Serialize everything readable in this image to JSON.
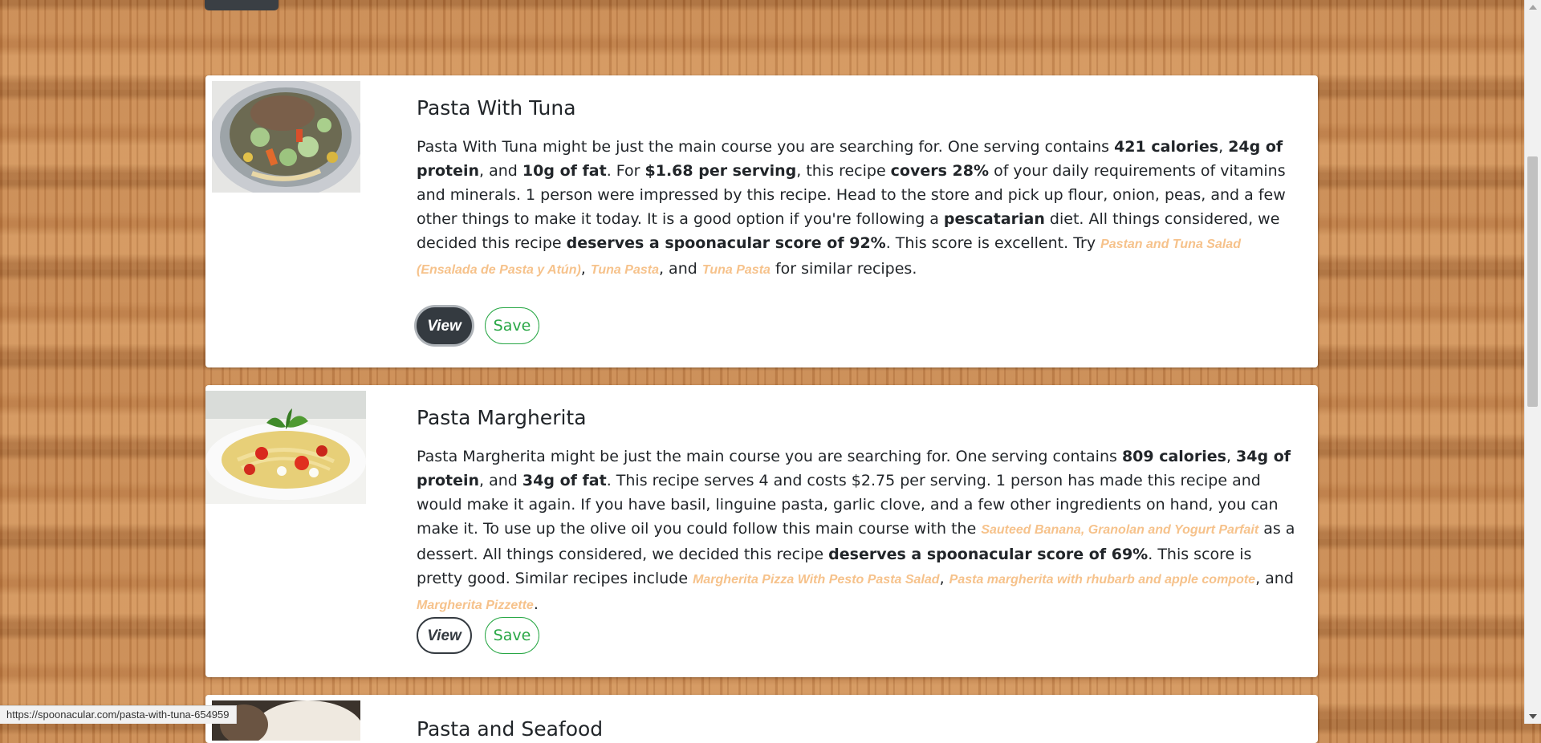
{
  "recipes": [
    {
      "title": "Pasta With Tuna",
      "summary_parts": [
        {
          "t": "text",
          "v": "Pasta With Tuna might be just the main course you are searching for. One serving contains "
        },
        {
          "t": "b",
          "v": "421 calories"
        },
        {
          "t": "text",
          "v": ", "
        },
        {
          "t": "b",
          "v": "24g of protein"
        },
        {
          "t": "text",
          "v": ", and "
        },
        {
          "t": "b",
          "v": "10g of fat"
        },
        {
          "t": "text",
          "v": ". For "
        },
        {
          "t": "b",
          "v": "$1.68 per serving"
        },
        {
          "t": "text",
          "v": ", this recipe "
        },
        {
          "t": "b",
          "v": "covers 28%"
        },
        {
          "t": "text",
          "v": " of your daily requirements of vitamins and minerals. 1 person were impressed by this recipe. Head to the store and pick up flour, onion, peas, and a few other things to make it today. It is a good option if you're following a "
        },
        {
          "t": "b",
          "v": "pescatarian"
        },
        {
          "t": "text",
          "v": " diet. All things considered, we decided this recipe "
        },
        {
          "t": "b",
          "v": "deserves a spoonacular score of 92%"
        },
        {
          "t": "text",
          "v": ". This score is excellent. Try "
        },
        {
          "t": "link",
          "v": "Pastan and Tuna Salad (Ensalada de Pasta y Atún)"
        },
        {
          "t": "text",
          "v": ", "
        },
        {
          "t": "link",
          "v": "Tuna Pasta"
        },
        {
          "t": "text",
          "v": ", and "
        },
        {
          "t": "link",
          "v": "Tuna Pasta"
        },
        {
          "t": "text",
          "v": " for similar recipes."
        }
      ],
      "view_label": "View",
      "save_label": "Save"
    },
    {
      "title": "Pasta Margherita",
      "summary_parts": [
        {
          "t": "text",
          "v": "Pasta Margherita might be just the main course you are searching for. One serving contains "
        },
        {
          "t": "b",
          "v": "809 calories"
        },
        {
          "t": "text",
          "v": ", "
        },
        {
          "t": "b",
          "v": "34g of protein"
        },
        {
          "t": "text",
          "v": ", and "
        },
        {
          "t": "b",
          "v": "34g of fat"
        },
        {
          "t": "text",
          "v": ". This recipe serves 4 and costs $2.75 per serving. 1 person has made this recipe and would make it again. If you have basil, linguine pasta, garlic clove, and a few other ingredients on hand, you can make it. To use up the olive oil you could follow this main course with the "
        },
        {
          "t": "link",
          "v": "Sauteed Banana, Granolan and Yogurt Parfait"
        },
        {
          "t": "text",
          "v": " as a dessert. All things considered, we decided this recipe "
        },
        {
          "t": "b",
          "v": "deserves a spoonacular score of 69%"
        },
        {
          "t": "text",
          "v": ". This score is pretty good. Similar recipes include "
        },
        {
          "t": "link",
          "v": "Margherita Pizza With Pesto Pasta Salad"
        },
        {
          "t": "text",
          "v": ", "
        },
        {
          "t": "link",
          "v": "Pasta margherita with rhubarb and apple compote"
        },
        {
          "t": "text",
          "v": ", and "
        },
        {
          "t": "link",
          "v": "Margherita Pizzette"
        },
        {
          "t": "text",
          "v": "."
        }
      ],
      "view_label": "View",
      "save_label": "Save"
    },
    {
      "title": "Pasta and Seafood"
    }
  ],
  "status_url": "https://spoonacular.com/pasta-with-tuna-654959",
  "colors": {
    "link": "#f6c28b",
    "save": "#28a745",
    "view": "#343a40"
  }
}
